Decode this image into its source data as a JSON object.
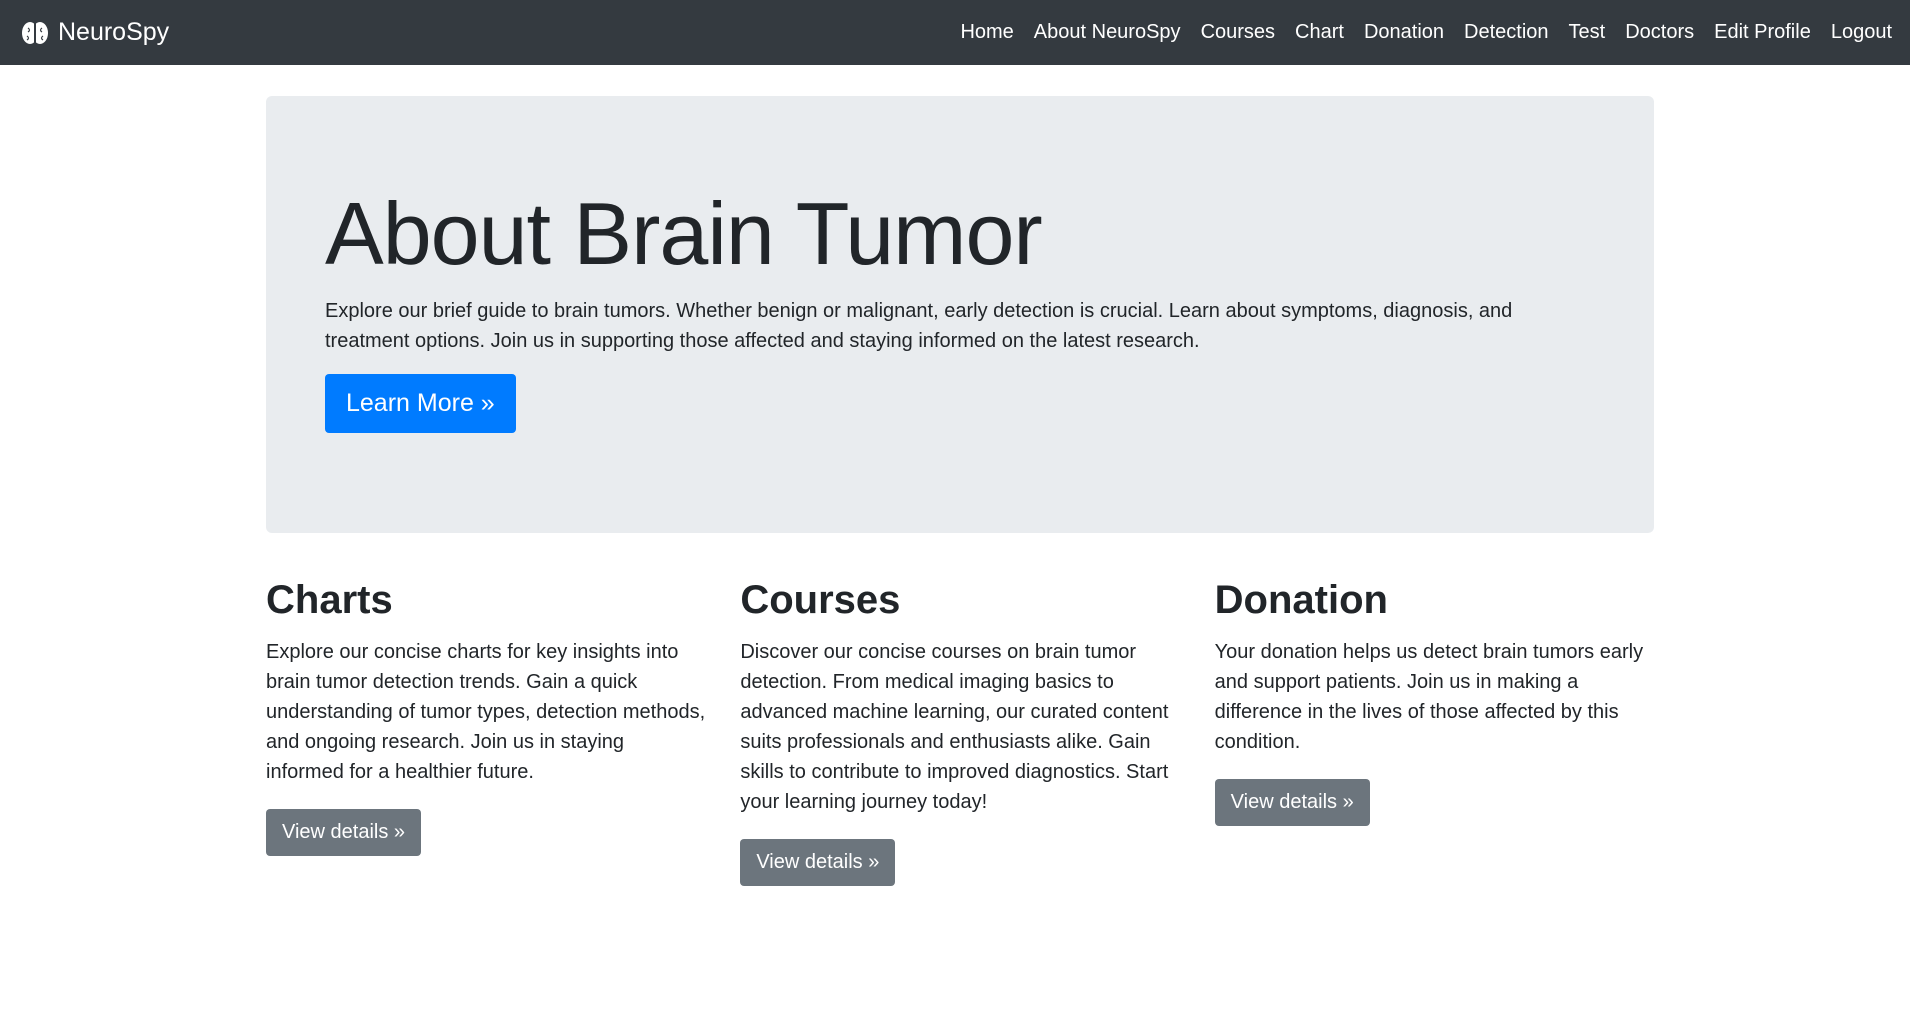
{
  "navbar": {
    "brand": "NeuroSpy",
    "brand_icon": "brain-icon",
    "links": [
      "Home",
      "About NeuroSpy",
      "Courses",
      "Chart",
      "Donation",
      "Detection",
      "Test",
      "Doctors",
      "Edit Profile",
      "Logout"
    ]
  },
  "hero": {
    "title": "About Brain Tumor",
    "text": "Explore our brief guide to brain tumors. Whether benign or malignant, early detection is crucial. Learn about symptoms, diagnosis, and treatment options. Join us in supporting those affected and staying informed on the latest research.",
    "button": "Learn More »"
  },
  "features": [
    {
      "title": "Charts",
      "text": "Explore our concise charts for key insights into brain tumor detection trends. Gain a quick understanding of tumor types, detection methods, and ongoing research. Join us in staying informed for a healthier future.",
      "button": "View details »"
    },
    {
      "title": "Courses",
      "text": "Discover our concise courses on brain tumor detection. From medical imaging basics to advanced machine learning, our curated content suits professionals and enthusiasts alike. Gain skills to contribute to improved diagnostics. Start your learning journey today!",
      "button": "View details »"
    },
    {
      "title": "Donation",
      "text": "Your donation helps us detect brain tumors early and support patients. Join us in making a difference in the lives of those affected by this condition.",
      "button": "View details »"
    }
  ],
  "colors": {
    "navbar_bg": "#343a40",
    "hero_bg": "#e9ecef",
    "primary": "#007bff",
    "secondary": "#6c757d"
  }
}
